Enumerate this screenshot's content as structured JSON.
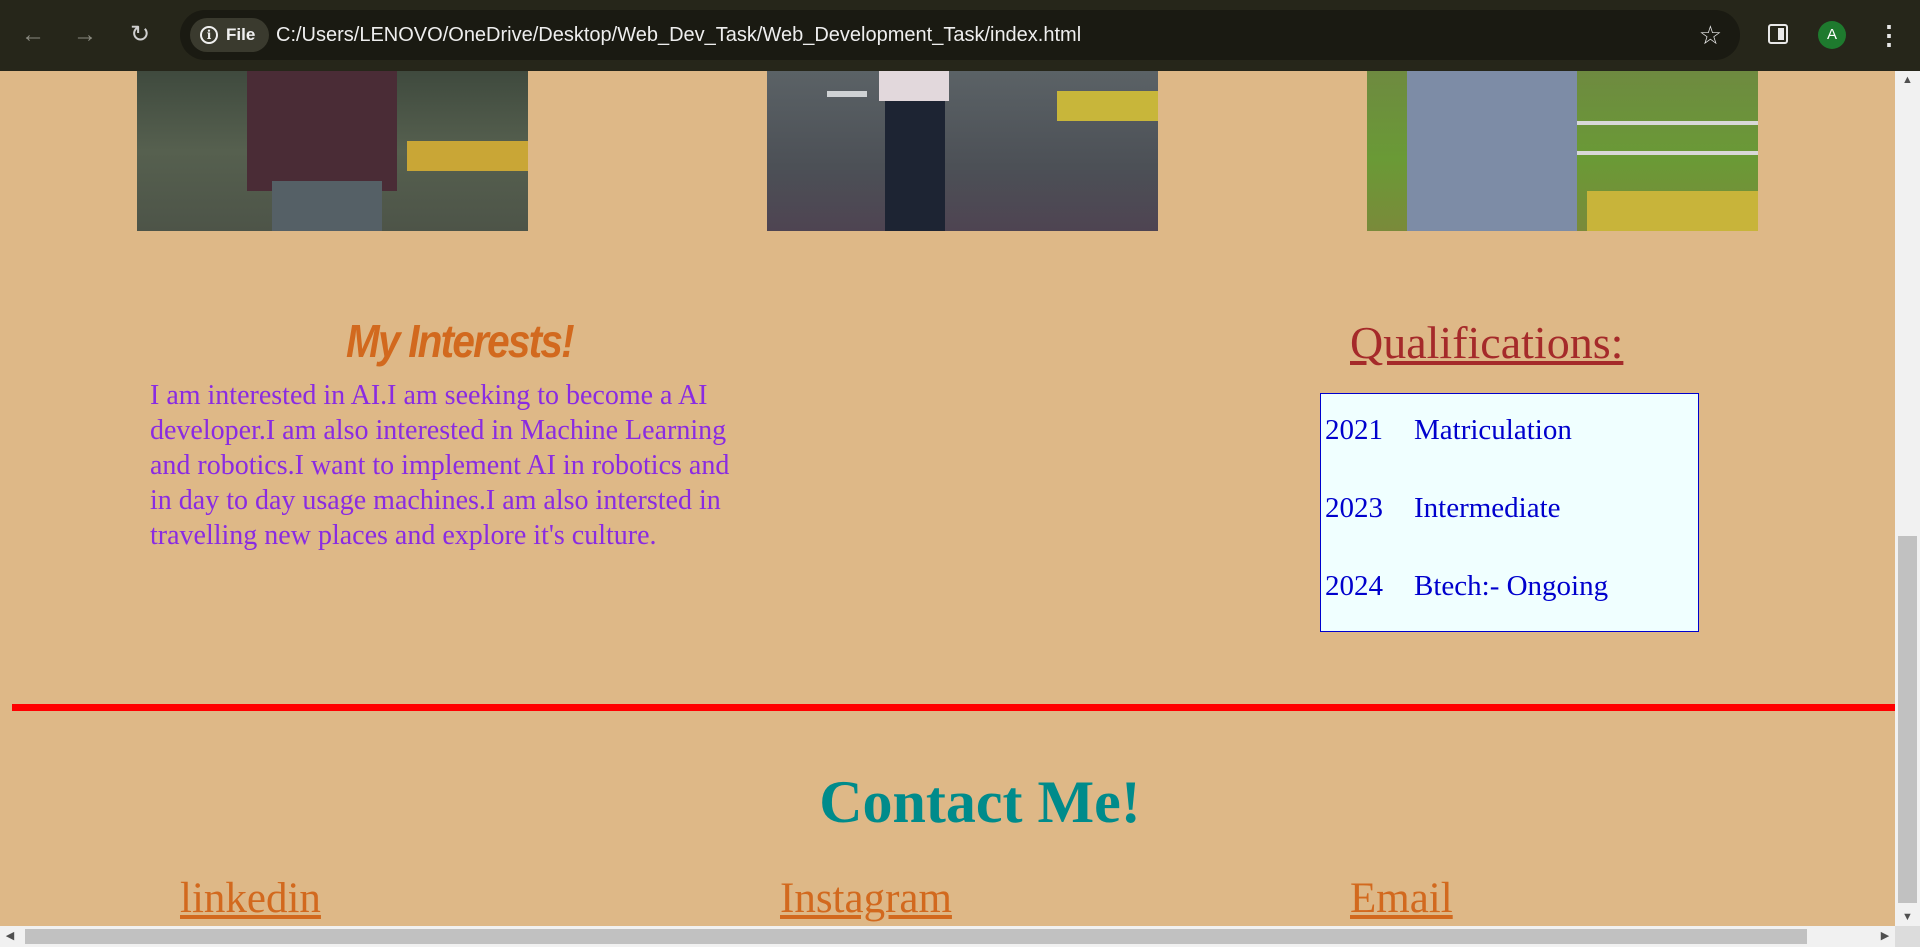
{
  "browser": {
    "back_icon": "arrow-left-icon",
    "forward_icon": "arrow-right-icon",
    "reload_icon": "reload-icon",
    "site_chip_label": "File",
    "url": "C:/Users/LENOVO/OneDrive/Desktop/Web_Dev_Task/Web_Development_Task/index.html",
    "profile_initial": "A",
    "colors": {
      "toolbar": "#26261a",
      "omnibox": "#1a1a12",
      "avatar": "#1e7a2e"
    }
  },
  "page": {
    "background": "#deb887",
    "photos": [
      "photo-1",
      "photo-2",
      "photo-3"
    ],
    "interests": {
      "title": "My Interests!",
      "text": "I am interested in AI.I am seeking to become a AI developer.I am also interested in Machine Learning and robotics.I want to implement AI in robotics and in day to day usage machines.I am also intersted in travelling new places and explore it's culture.",
      "title_color": "#d2691e",
      "text_color": "#8a2be2"
    },
    "qualifications": {
      "title": "Qualifications:",
      "rows": [
        {
          "year": "2021",
          "label": "Matriculation"
        },
        {
          "year": "2023",
          "label": "Intermediate"
        },
        {
          "year": "2024",
          "label": "Btech:- Ongoing"
        }
      ],
      "title_color": "#a52a2a",
      "text_color": "#0000cd",
      "box_background": "#f0ffff"
    },
    "divider_color": "#ff0000",
    "contact": {
      "title": "Contact Me!",
      "title_color": "#008b8b",
      "links": [
        {
          "label": "linkedin"
        },
        {
          "label": "Instagram"
        },
        {
          "label": "Email"
        }
      ],
      "link_color": "#d2691e"
    }
  }
}
